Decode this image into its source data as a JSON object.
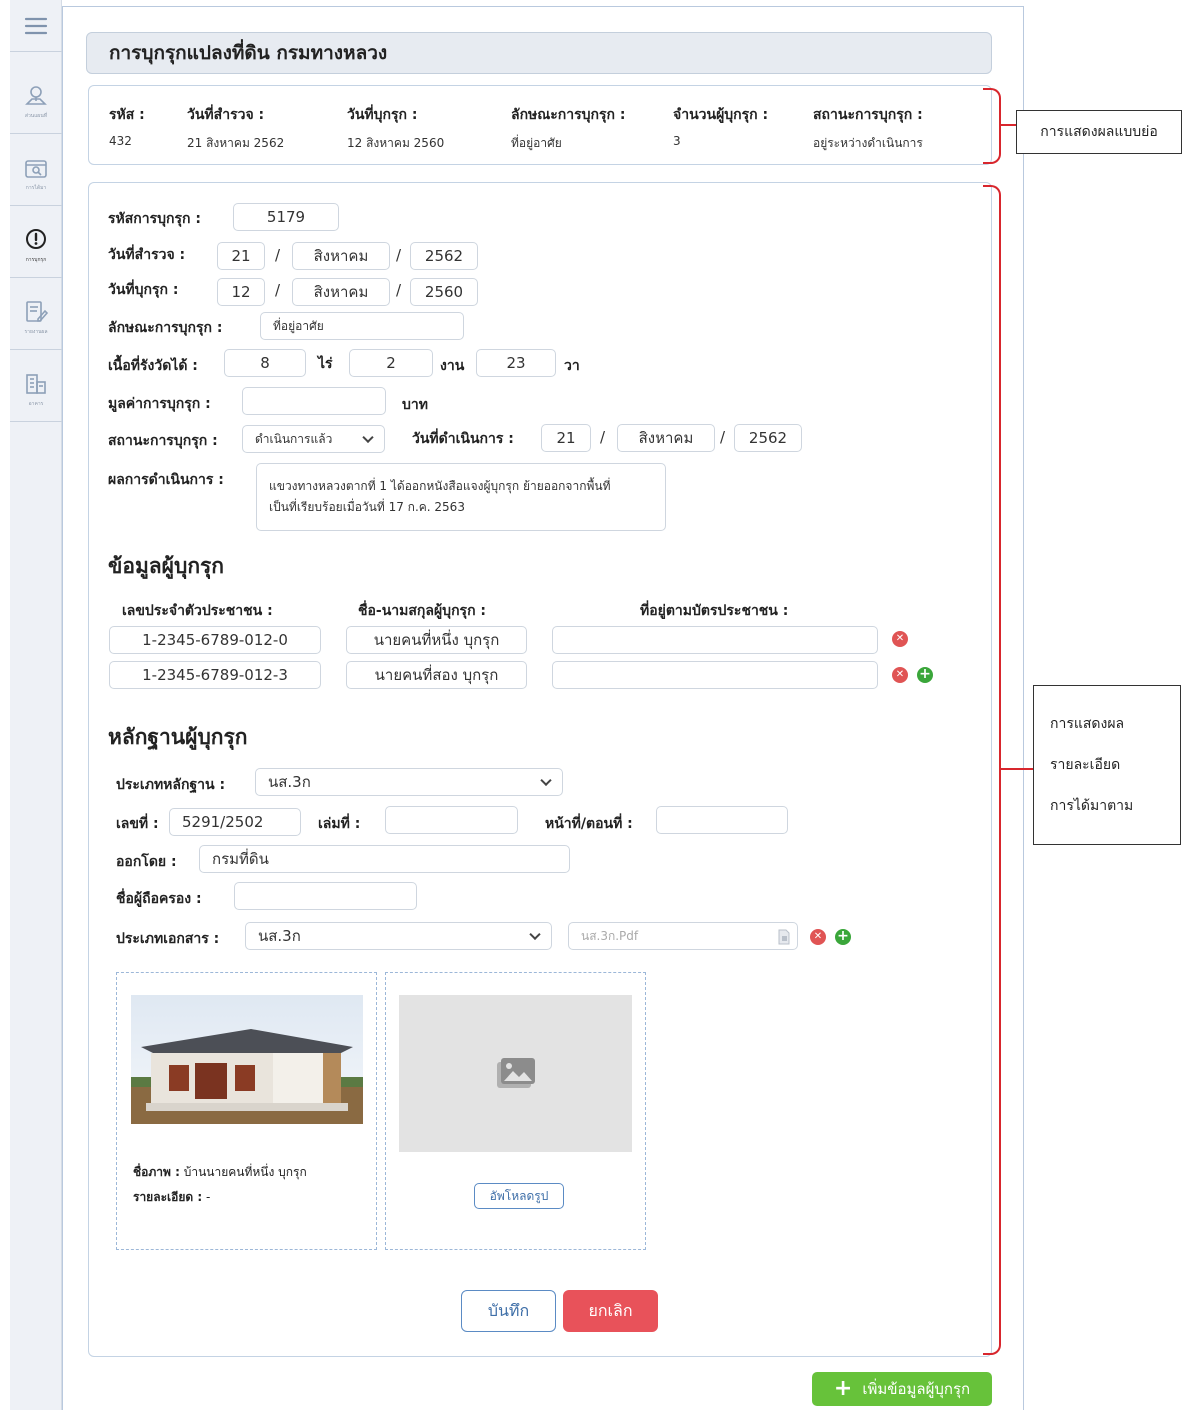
{
  "sidebar": {
    "items": [
      {
        "icon": "menu-icon",
        "caption": ""
      },
      {
        "icon": "map-pin-icon",
        "caption": "ส่วนแผนที่"
      },
      {
        "icon": "search-document-icon",
        "caption": "การได้มา"
      },
      {
        "icon": "alert-circle-icon",
        "caption": "การบุกรุก"
      },
      {
        "icon": "edit-report-icon",
        "caption": "รายงานผล"
      },
      {
        "icon": "building-icon",
        "caption": "อาคาร"
      }
    ]
  },
  "header": {
    "title": "การบุกรุกแปลงที่ดิน กรมทางหลวง"
  },
  "summary": {
    "code_label": "รหัส :",
    "code": "432",
    "survey_date_label": "วันที่สำรวจ :",
    "survey_date": "21 สิงหาคม 2562",
    "trespass_date_label": "วันที่บุกรุก :",
    "trespass_date": "12 สิงหาคม 2560",
    "type_label": "ลักษณะการบุกรุก :",
    "type": "ที่อยู่อาศัย",
    "count_label": "จำนวนผู้บุกรุก :",
    "count": "3",
    "status_label": "สถานะการบุกรุก :",
    "status": "อยู่ระหว่างดำเนินการ"
  },
  "form": {
    "code_label": "รหัสการบุกรุก :",
    "code": "5179",
    "survey_label": "วันที่สำรวจ :",
    "survey_day": "21",
    "survey_month": "สิงหาคม",
    "survey_year": "2562",
    "trespass_label": "วันที่บุกรุก :",
    "trespass_day": "12",
    "trespass_month": "สิงหาคม",
    "trespass_year": "2560",
    "slash": "/",
    "type_label": "ลักษณะการบุกรุก :",
    "type": "ที่อยู่อาศัย",
    "area_label": "เนื้อที่รังวัดได้ :",
    "rai": "8",
    "rai_unit": "ไร่",
    "ngan": "2",
    "ngan_unit": "งาน",
    "wa": "23",
    "wa_unit": "วา",
    "value_label": "มูลค่าการบุกรุก :",
    "value": "",
    "value_unit": "บาท",
    "status_label": "สถานะการบุกรุก :",
    "status": "ดำเนินการแล้ว",
    "action_date_label": "วันที่ดำเนินการ :",
    "action_day": "21",
    "action_month": "สิงหาคม",
    "action_year": "2562",
    "result_label": "ผลการดำเนินการ :",
    "result_line1": "แขวงทางหลวงตากที่ 1 ได้ออกหนังสือแจงผู้บุกรุก ย้ายออกจากพื้นที่",
    "result_line2": "เป็นที่เรียบร้อยเมื่อวันที่ 17 ก.ค. 2563"
  },
  "trespassers": {
    "title": "ข้อมูลผู้บุกรุก",
    "col_id": "เลขประจำตัวประชาชน :",
    "col_name": "ชื่อ-นามสกุลผู้บุกรุก :",
    "col_address": "ที่อยู่ตามบัตรประชาชน :",
    "rows": [
      {
        "id": "1-2345-6789-012-0",
        "name": "นายคนที่หนึ่ง บุกรุก",
        "address": ""
      },
      {
        "id": "1-2345-6789-012-3",
        "name": "นายคนที่สอง บุกรุก",
        "address": ""
      }
    ]
  },
  "evidence": {
    "title": "หลักฐานผู้บุกรุก",
    "type_label": "ประเภทหลักฐาน :",
    "type": "นส.3ก",
    "no_label": "เลขที่ :",
    "no": "5291/2502",
    "book_label": "เล่มที่ :",
    "book": "",
    "page_label": "หน้าที่/ตอนที่ :",
    "page": "",
    "issuer_label": "ออกโดย :",
    "issuer": "กรมที่ดิน",
    "holder_label": "ชื่อผู้ถือครอง :",
    "holder": "",
    "doc_type_label": "ประเภทเอกสาร :",
    "doc_type": "นส.3ก",
    "file_placeholder": "นส.3ก.Pdf",
    "photo_name_label": "ชื่อภาพ :",
    "photo_name": "บ้านนายคนที่หนึ่ง บุกรุก",
    "photo_detail_label": "รายละเอียด :",
    "photo_detail": "-",
    "upload_label": "อัพโหลดรูป"
  },
  "actions": {
    "save": "บันทึก",
    "cancel": "ยกเลิก",
    "add_trespasser": "เพิ่มข้อมูลผู้บุกรุก"
  },
  "annotations": {
    "summary_note": "การแสดงผลแบบย่อ",
    "detail_note_1": "การแสดงผล",
    "detail_note_2": "รายละเอียด",
    "detail_note_3": "การได้มาตาม"
  }
}
